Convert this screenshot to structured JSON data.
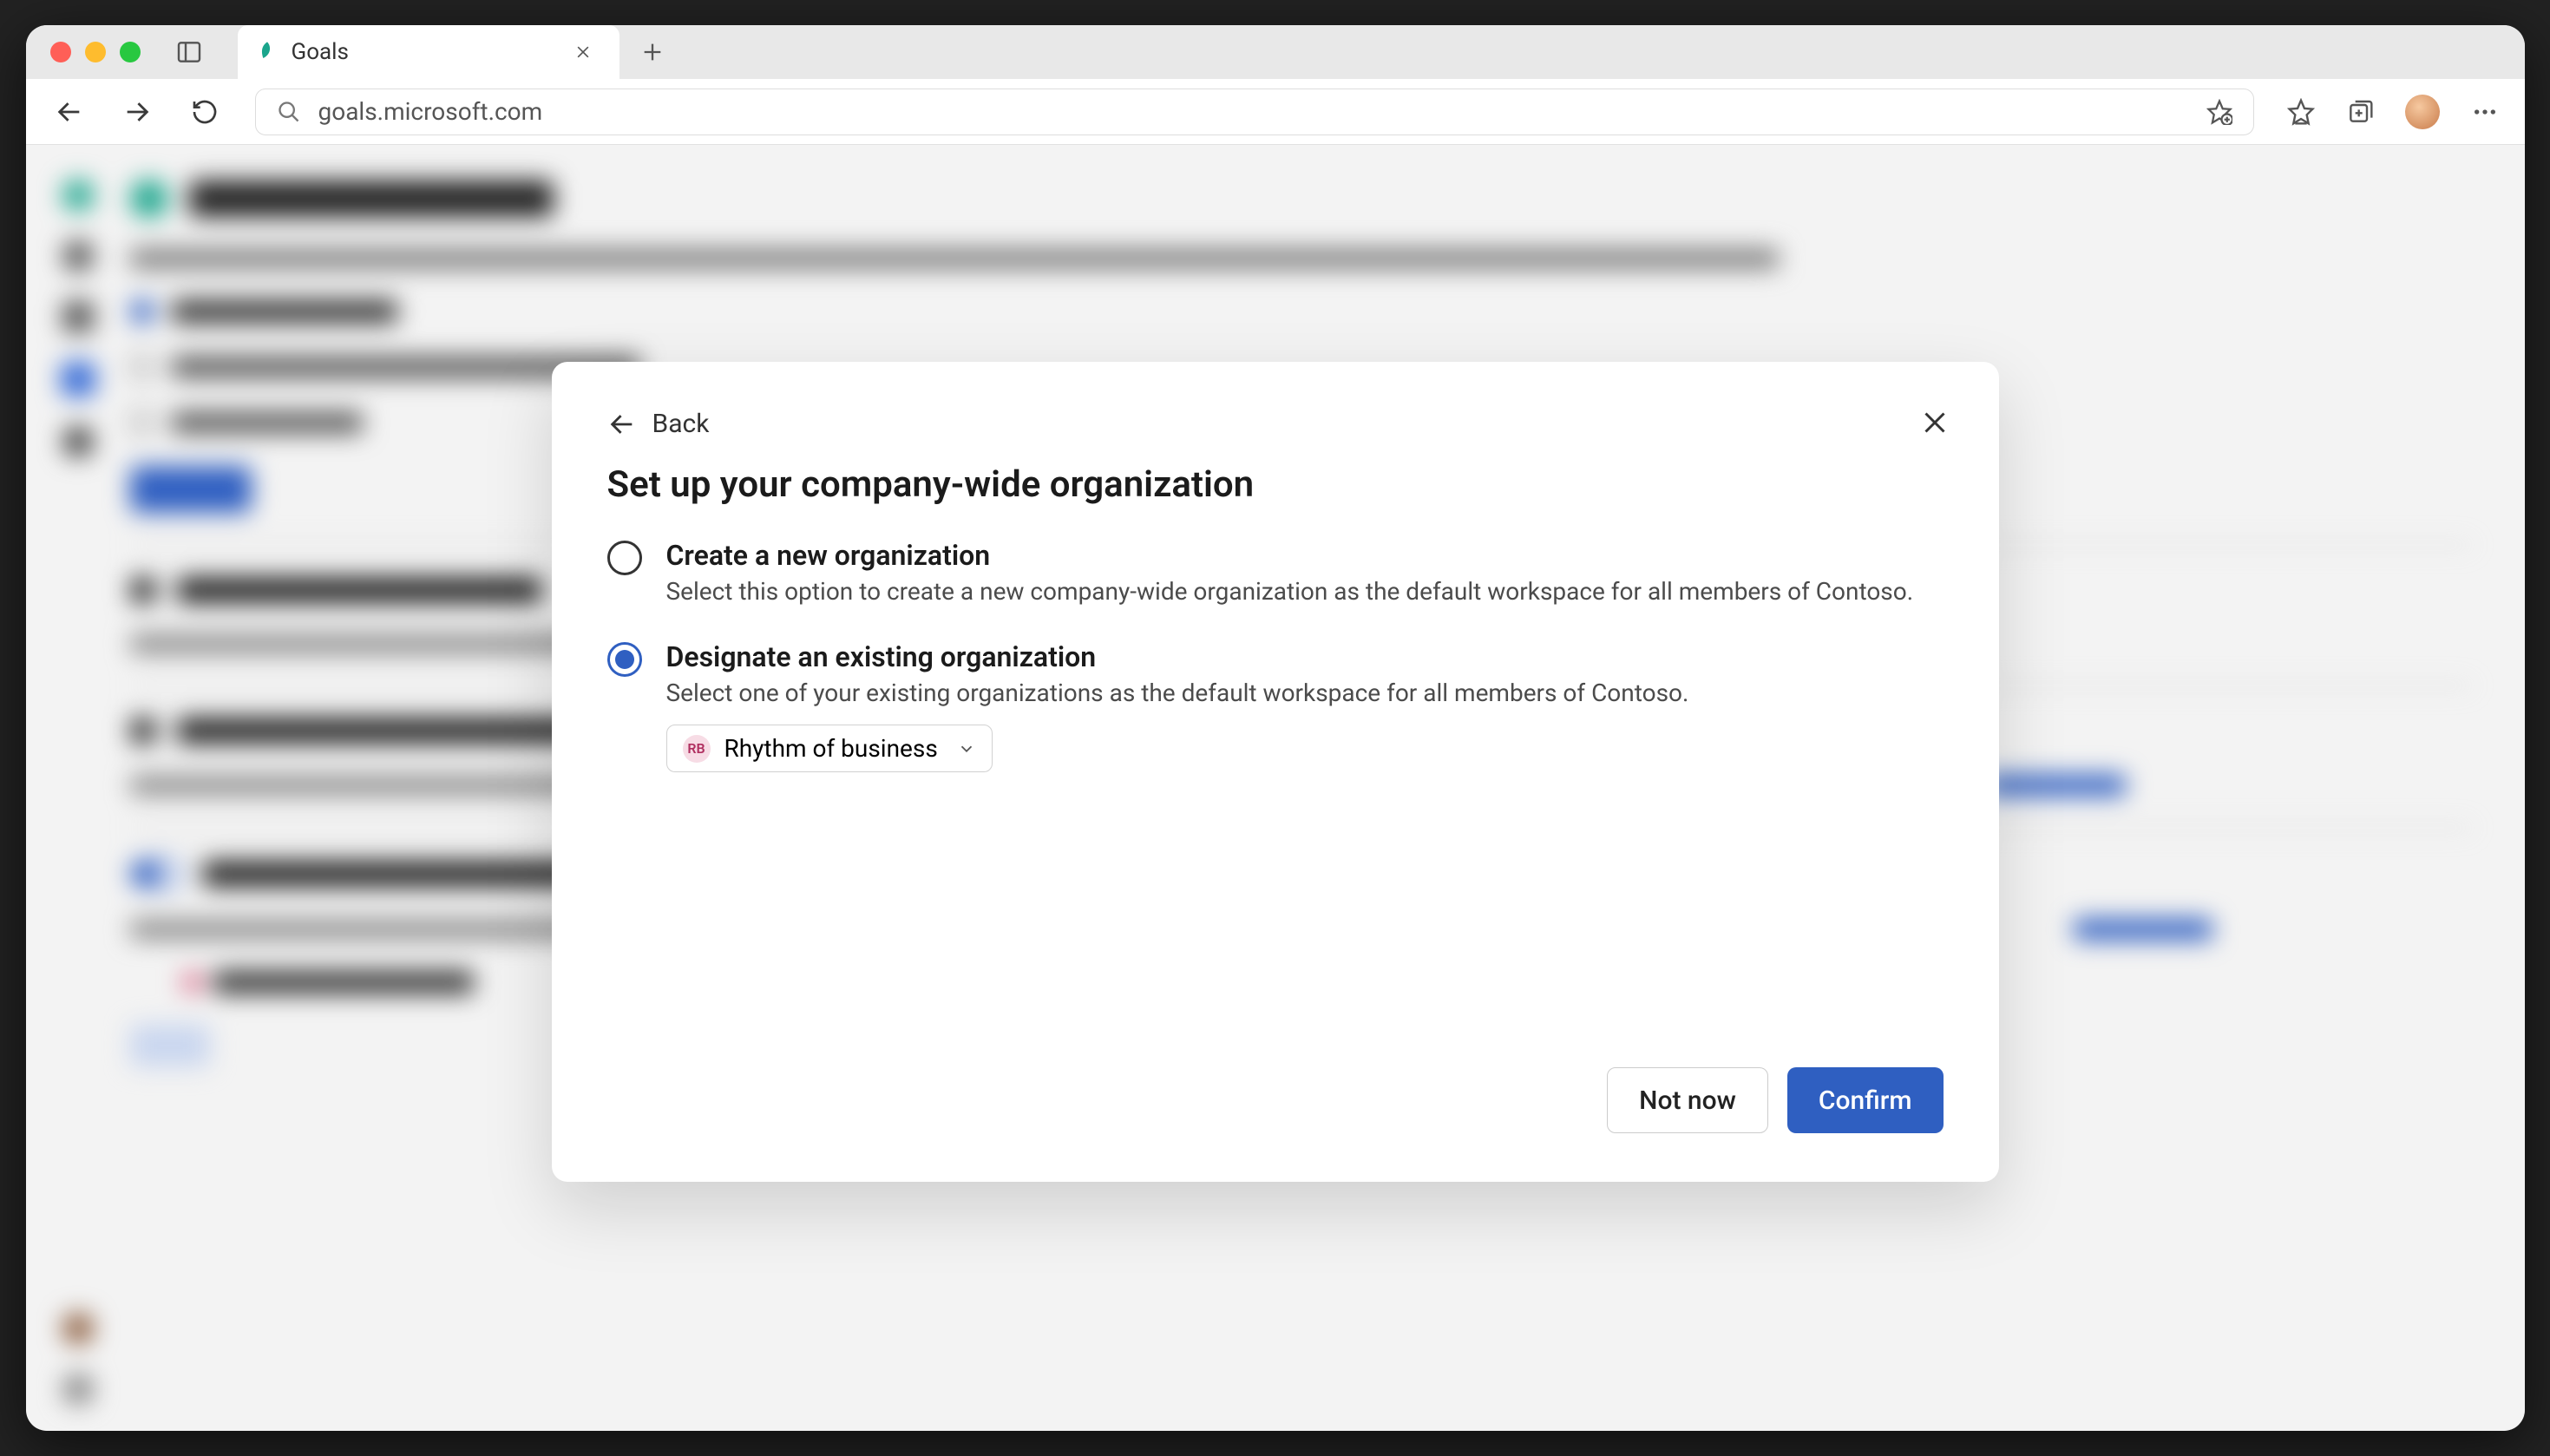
{
  "browser": {
    "tab_title": "Goals",
    "url": "goals.microsoft.com"
  },
  "modal": {
    "back_label": "Back",
    "title": "Set up your company-wide organization",
    "options": {
      "create": {
        "title": "Create a new organization",
        "desc": "Select this option to create a new company-wide organization as the default workspace for all members of Contoso."
      },
      "designate": {
        "title": "Designate an existing organization",
        "desc": "Select one of your existing organizations as the default workspace for all members of Contoso."
      }
    },
    "org_picker": {
      "badge": "RB",
      "selected": "Rhythm of business"
    },
    "not_now": "Not now",
    "confirm": "Confirm"
  }
}
